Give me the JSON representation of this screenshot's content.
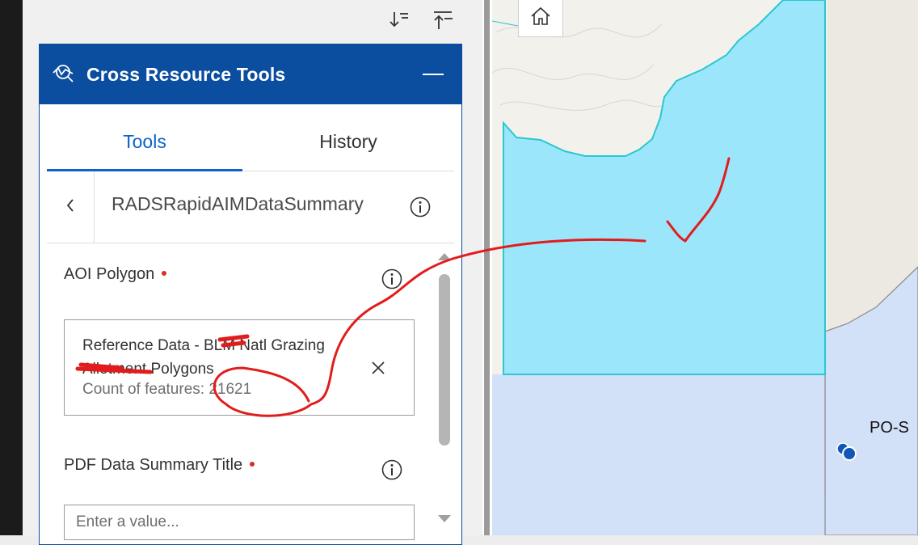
{
  "toolbar": {
    "expand_all_icon": "expand-all-icon",
    "collapse_all_icon": "collapse-all-icon"
  },
  "widget": {
    "title": "Cross Resource Tools",
    "icon": "cross-resource-tools-icon",
    "accent_color": "#0b4d9f"
  },
  "tabs": [
    {
      "label": "Tools",
      "active": true
    },
    {
      "label": "History",
      "active": false
    }
  ],
  "tool": {
    "name": "RADSRapidAIMDataSummary"
  },
  "form": {
    "aoi": {
      "label": "AOI Polygon",
      "required": true,
      "selection": {
        "name": "Reference Data - BLM Natl Grazing Allotment Polygons",
        "count": "Count of features: 21621"
      }
    },
    "pdf_title": {
      "label": "PDF Data Summary Title",
      "required": true,
      "value": "",
      "placeholder": "Enter a value..."
    }
  },
  "map": {
    "feature_label": "PO-S",
    "colors": {
      "polygon_fill": "#9be6fa",
      "polygon_outline": "#2ac8d0",
      "region_fill": "#d2e0f8",
      "terrain": "#f2f1ec",
      "point": "#1257b7",
      "annotation": "#e21c1c"
    }
  }
}
